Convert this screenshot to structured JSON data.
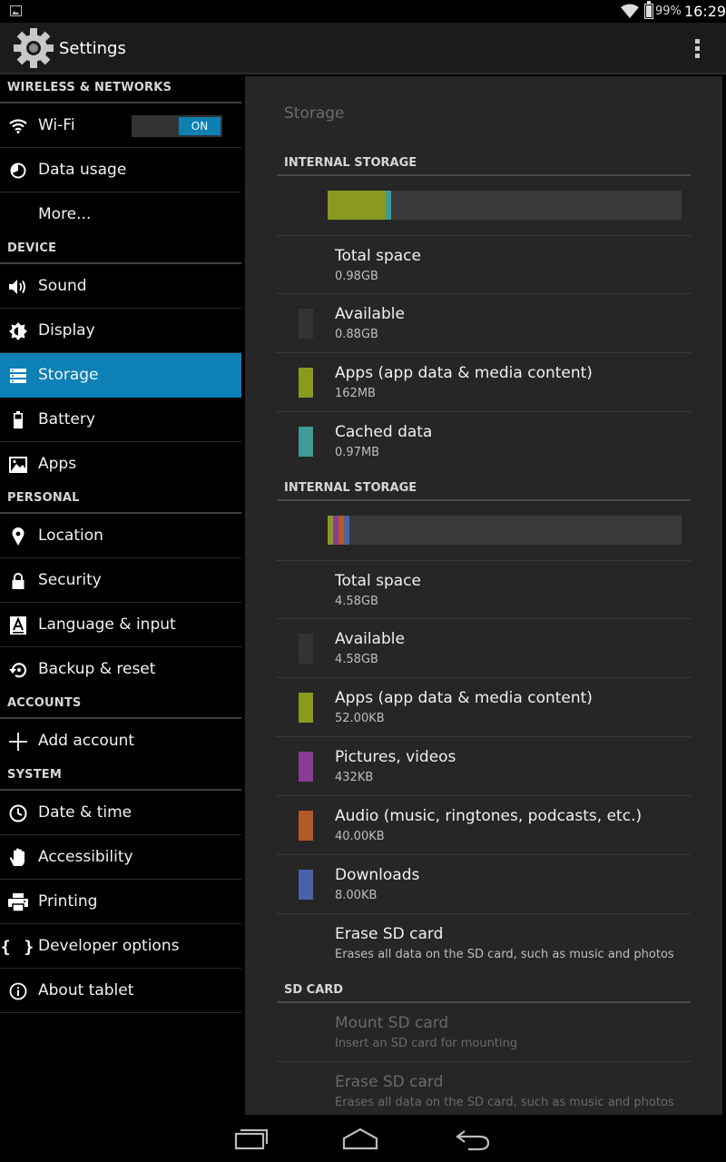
{
  "status_bar": {
    "battery": "99%",
    "time": "16:29"
  },
  "app_bar": {
    "title": "Settings"
  },
  "sidebar": {
    "sections": [
      {
        "header": "WIRELESS & NETWORKS",
        "items": [
          {
            "label": "Wi-Fi",
            "icon": "wifi-icon",
            "toggle": "ON"
          },
          {
            "label": "Data usage",
            "icon": "data-usage-icon"
          },
          {
            "label": "More...",
            "icon": ""
          }
        ]
      },
      {
        "header": "DEVICE",
        "items": [
          {
            "label": "Sound",
            "icon": "speaker-icon"
          },
          {
            "label": "Display",
            "icon": "brightness-icon"
          },
          {
            "label": "Storage",
            "icon": "storage-icon",
            "selected": true
          },
          {
            "label": "Battery",
            "icon": "battery-icon"
          },
          {
            "label": "Apps",
            "icon": "apps-icon"
          }
        ]
      },
      {
        "header": "PERSONAL",
        "items": [
          {
            "label": "Location",
            "icon": "location-pin-icon"
          },
          {
            "label": "Security",
            "icon": "lock-icon"
          },
          {
            "label": "Language & input",
            "icon": "keyboard-a-icon"
          },
          {
            "label": "Backup & reset",
            "icon": "backup-restore-icon"
          }
        ]
      },
      {
        "header": "ACCOUNTS",
        "items": [
          {
            "label": "Add account",
            "icon": "plus-icon"
          }
        ]
      },
      {
        "header": "SYSTEM",
        "items": [
          {
            "label": "Date & time",
            "icon": "clock-icon"
          },
          {
            "label": "Accessibility",
            "icon": "hand-icon"
          },
          {
            "label": "Printing",
            "icon": "printer-icon"
          },
          {
            "label": "Developer options",
            "icon": "braces-icon"
          },
          {
            "label": "About tablet",
            "icon": "info-icon"
          }
        ]
      }
    ]
  },
  "storage": {
    "title": "Storage",
    "internal_1": {
      "header": "INTERNAL STORAGE",
      "usage_fractions": {
        "apps": 0.163,
        "cached": 0.015
      },
      "rows": [
        {
          "title": "Total space",
          "sub": "0.98GB",
          "swatch": ""
        },
        {
          "title": "Available",
          "sub": "0.88GB",
          "swatch": "#333333"
        },
        {
          "title": "Apps (app data & media content)",
          "sub": "162MB",
          "swatch": "#8a9a1e"
        },
        {
          "title": "Cached data",
          "sub": "0.97MB",
          "swatch": "#3f9a9a"
        }
      ]
    },
    "internal_2": {
      "header": "INTERNAL STORAGE",
      "usage_fractions": {
        "apps": 0.015,
        "pictures": 0.015,
        "audio": 0.015,
        "downloads": 0.015
      },
      "rows": [
        {
          "title": "Total space",
          "sub": "4.58GB",
          "swatch": ""
        },
        {
          "title": "Available",
          "sub": "4.58GB",
          "swatch": "#333333"
        },
        {
          "title": "Apps (app data & media content)",
          "sub": "52.00KB",
          "swatch": "#8a9a1e"
        },
        {
          "title": "Pictures, videos",
          "sub": "432KB",
          "swatch": "#8a3c96"
        },
        {
          "title": "Audio (music, ringtones, podcasts, etc.)",
          "sub": "40.00KB",
          "swatch": "#b45a28"
        },
        {
          "title": "Downloads",
          "sub": "8.00KB",
          "swatch": "#4a62aa"
        },
        {
          "title": "Erase SD card",
          "sub": "Erases all data on the SD card, such as music and photos",
          "swatch": ""
        }
      ]
    },
    "sd_card": {
      "header": "SD CARD",
      "rows": [
        {
          "title": "Mount SD card",
          "sub": "Insert an SD card for mounting"
        },
        {
          "title": "Erase SD card",
          "sub": "Erases all data on the SD card, such as music and photos"
        }
      ]
    }
  },
  "colors": {
    "accent": "#0d80b5",
    "apps": "#8a9a1e",
    "cached": "#3f9a9a",
    "pictures": "#8a3c96",
    "audio": "#b45a28",
    "downloads": "#4a62aa"
  }
}
